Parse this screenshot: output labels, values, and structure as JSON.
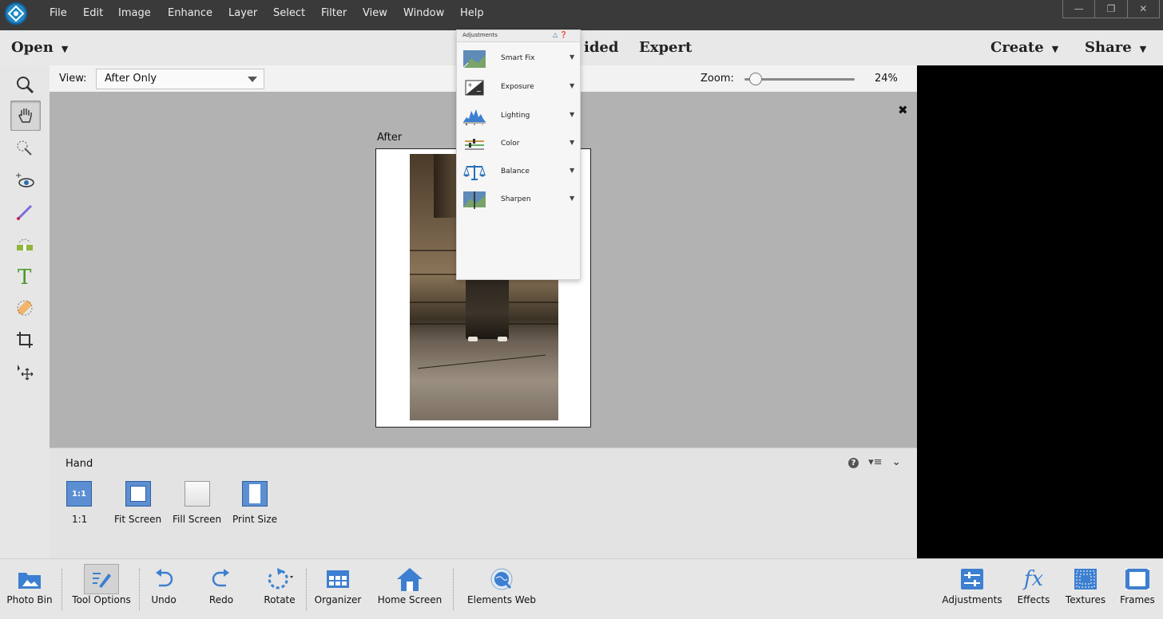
{
  "menubar": {
    "items": [
      "File",
      "Edit",
      "Image",
      "Enhance",
      "Layer",
      "Select",
      "Filter",
      "View",
      "Window",
      "Help"
    ]
  },
  "modebar": {
    "open_label": "Open",
    "guided_label": "ided",
    "expert_label": "Expert",
    "create_label": "Create",
    "share_label": "Share"
  },
  "view": {
    "label": "View:",
    "selected": "After Only"
  },
  "zoom": {
    "label": "Zoom:",
    "value": "24%",
    "level": 0.05
  },
  "canvas": {
    "after_label": "After"
  },
  "adjustments": {
    "title": "Adjustments",
    "items": [
      {
        "label": "Smart Fix",
        "icon": "smart-fix-icon"
      },
      {
        "label": "Exposure",
        "icon": "exposure-icon"
      },
      {
        "label": "Lighting",
        "icon": "lighting-icon"
      },
      {
        "label": "Color",
        "icon": "color-icon"
      },
      {
        "label": "Balance",
        "icon": "balance-icon"
      },
      {
        "label": "Sharpen",
        "icon": "sharpen-icon"
      }
    ]
  },
  "tool_options": {
    "tool_name": "Hand",
    "buttons": [
      {
        "label": "1:1",
        "icon_text": "1:1"
      },
      {
        "label": "Fit Screen"
      },
      {
        "label": "Fill Screen"
      },
      {
        "label": "Print Size"
      }
    ]
  },
  "taskbar": {
    "left": [
      "Photo Bin",
      "Tool Options",
      "Undo",
      "Redo",
      "Rotate",
      "Organizer",
      "Home Screen",
      "Elements Web"
    ],
    "right": [
      "Adjustments",
      "Effects",
      "Textures",
      "Frames"
    ]
  },
  "colors": {
    "menubar_bg": "#3a3a3a",
    "canvas_bg": "#b2b2b2",
    "accent_blue": "#4a7fc0"
  }
}
